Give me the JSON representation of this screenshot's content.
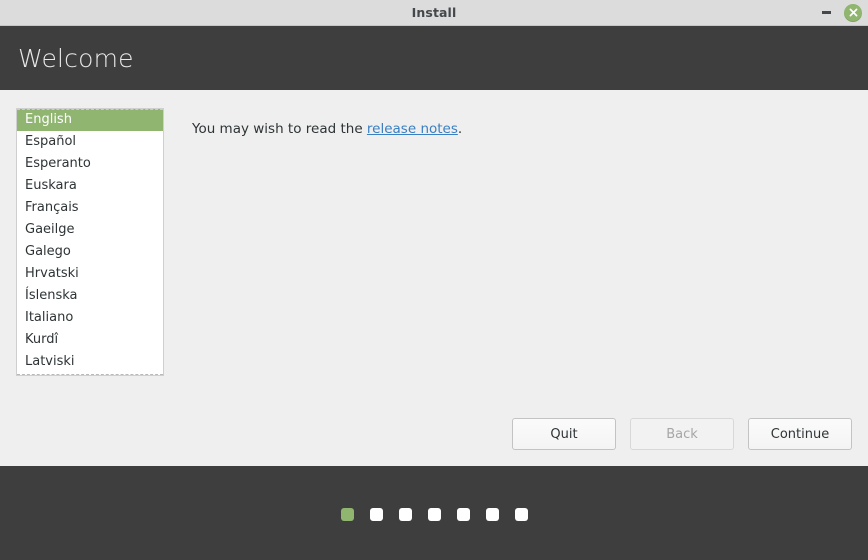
{
  "titlebar": {
    "title": "Install",
    "minimize_icon": "minimize-icon",
    "close_icon": "close-icon",
    "background_color": "#dcdcdc",
    "close_button_color": "#8fb56e"
  },
  "header": {
    "title": "Welcome",
    "background_color": "#3e3e3e"
  },
  "language_list": {
    "selected": "English",
    "items": [
      {
        "label": "English",
        "selected": true
      },
      {
        "label": "Español",
        "selected": false
      },
      {
        "label": "Esperanto",
        "selected": false
      },
      {
        "label": "Euskara",
        "selected": false
      },
      {
        "label": "Français",
        "selected": false
      },
      {
        "label": "Gaeilge",
        "selected": false
      },
      {
        "label": "Galego",
        "selected": false
      },
      {
        "label": "Hrvatski",
        "selected": false
      },
      {
        "label": "Íslenska",
        "selected": false
      },
      {
        "label": "Italiano",
        "selected": false
      },
      {
        "label": "Kurdî",
        "selected": false
      },
      {
        "label": "Latviski",
        "selected": false
      }
    ],
    "selection_color": "#8fb570"
  },
  "content": {
    "text_before_link": "You may wish to read the ",
    "link_label": "release notes",
    "text_after_link": ".",
    "link_color": "#3a7fc1"
  },
  "buttons": {
    "quit_label": "Quit",
    "back_label": "Back",
    "back_disabled": true,
    "continue_label": "Continue"
  },
  "progress": {
    "total_steps": 7,
    "current_step": 1,
    "active_color": "#8fb56e",
    "inactive_color": "#ffffff",
    "background_color": "#3e3e3e"
  }
}
